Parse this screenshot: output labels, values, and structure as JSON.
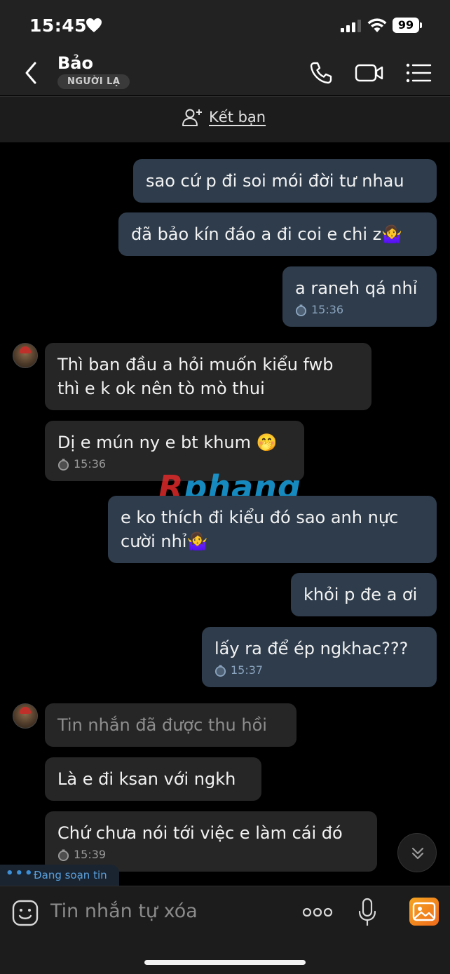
{
  "status_bar": {
    "time": "15:45",
    "battery": "99"
  },
  "header": {
    "name": "Bảo",
    "badge": "NGƯỜI LẠ"
  },
  "add_friend": {
    "label": "Kết bạn"
  },
  "messages": [
    {
      "text": "sao cứ p đi soi mói đời tư nhau"
    },
    {
      "text": "đã bảo kín đáo a đi coi e chi z🤷‍♀️"
    },
    {
      "text": "a raneh qá nhỉ",
      "time": "15:36"
    },
    {
      "text1": "Thì ban đầu a hỏi muốn kiểu fwb",
      "text2": "thì e k ok nên tò mò thui"
    },
    {
      "text": "Dị e mún ny e bt khum 🤭",
      "time": "15:36"
    },
    {
      "text1": "e ko thích đi kiểu đó sao anh nực",
      "text2": "cười nhỉ🤷‍♀️"
    },
    {
      "text": "khỏi p đe a ơi"
    },
    {
      "text": "lấy ra để ép ngkhac???",
      "time": "15:37"
    },
    {
      "text": "Tin nhắn đã được thu hồi"
    },
    {
      "text": "Là e đi ksan với ngkh"
    },
    {
      "text": "Chứ chưa nói tới việc e làm cái đó",
      "time": "15:39"
    }
  ],
  "watermark": {
    "part1": "R",
    "part2": "phang"
  },
  "typing": {
    "dots": "•••",
    "text": "Đang soạn tin"
  },
  "input": {
    "placeholder": "Tin nhắn tự xóa",
    "more": "ooo"
  },
  "colors": {
    "outgoing_bubble": "#2e3c4c",
    "incoming_bubble": "#262626",
    "accent": "#3d8fd6"
  },
  "icons": [
    "heart-icon",
    "signal-icon",
    "wifi-icon",
    "back-icon",
    "phone-icon",
    "video-icon",
    "menu-icon",
    "add-user-icon",
    "clock-icon",
    "chevron-down-icon",
    "sticker-icon",
    "mic-icon",
    "image-icon"
  ]
}
